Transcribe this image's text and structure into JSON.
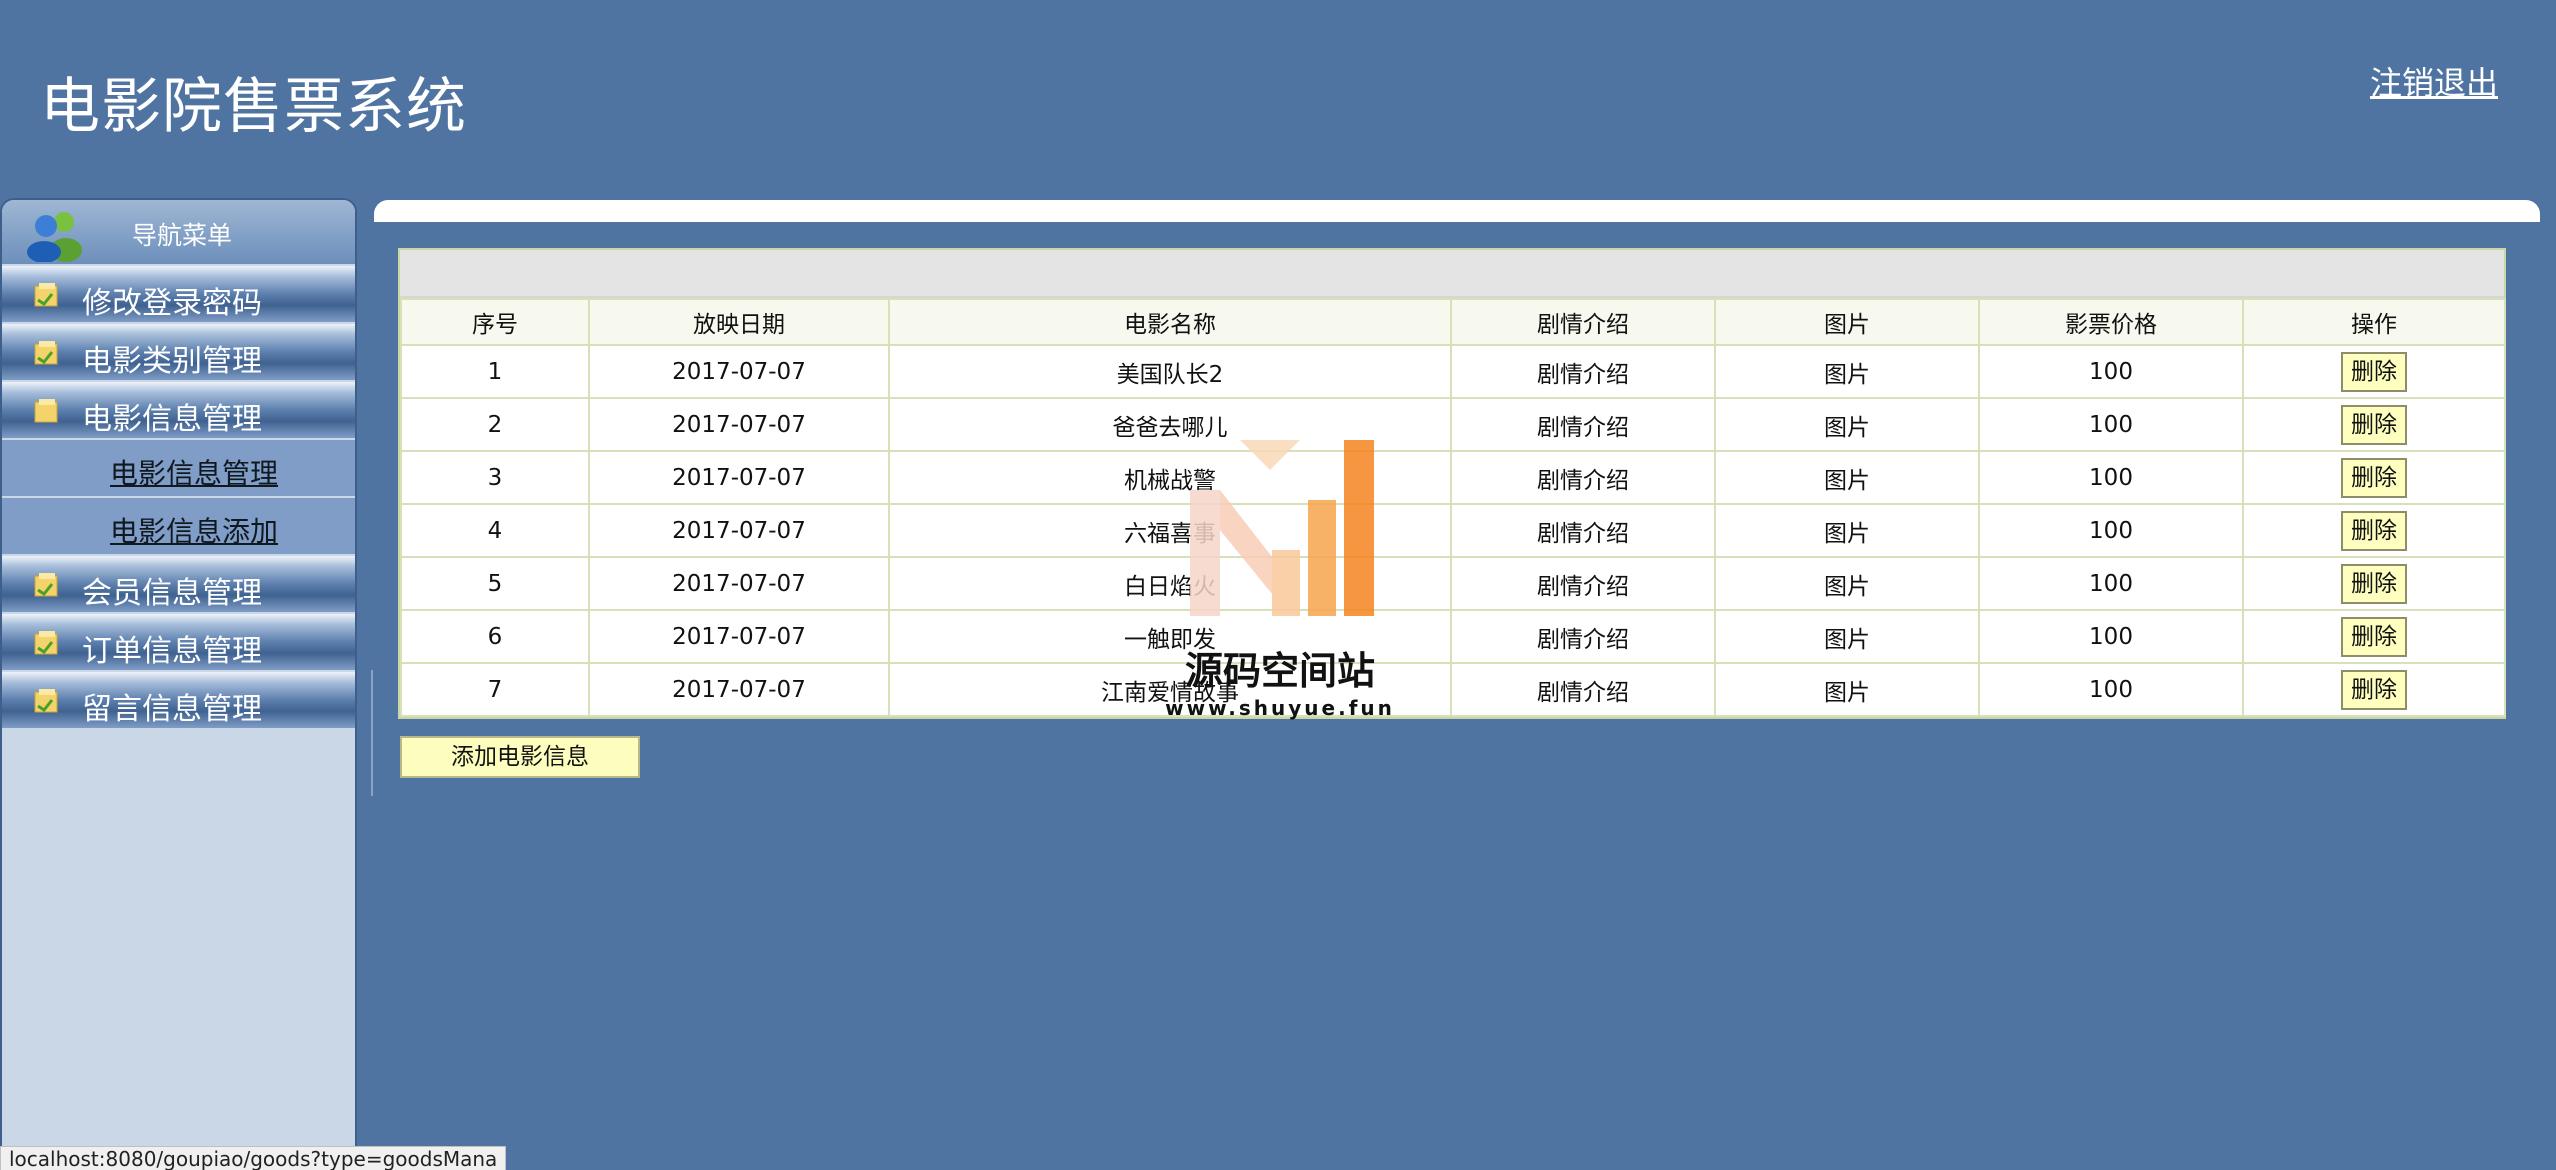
{
  "header": {
    "title": "电影院售票系统",
    "logout_label": "注销退出"
  },
  "sidebar": {
    "header_label": "导航菜单",
    "items": [
      {
        "label": "修改登录密码"
      },
      {
        "label": "电影类别管理"
      },
      {
        "label": "电影信息管理"
      },
      {
        "label": "会员信息管理"
      },
      {
        "label": "订单信息管理"
      },
      {
        "label": "留言信息管理"
      }
    ],
    "subitems": [
      {
        "label": "电影信息管理"
      },
      {
        "label": "电影信息添加"
      }
    ]
  },
  "table": {
    "headers": [
      "序号",
      "放映日期",
      "电影名称",
      "剧情介绍",
      "图片",
      "影票价格",
      "操作"
    ],
    "rows": [
      {
        "id": "1",
        "date": "2017-07-07",
        "name": "美国队长2",
        "plot": "剧情介绍",
        "image": "图片",
        "price": "100",
        "action": "删除"
      },
      {
        "id": "2",
        "date": "2017-07-07",
        "name": "爸爸去哪儿",
        "plot": "剧情介绍",
        "image": "图片",
        "price": "100",
        "action": "删除"
      },
      {
        "id": "3",
        "date": "2017-07-07",
        "name": "机械战警",
        "plot": "剧情介绍",
        "image": "图片",
        "price": "100",
        "action": "删除"
      },
      {
        "id": "4",
        "date": "2017-07-07",
        "name": "六福喜事",
        "plot": "剧情介绍",
        "image": "图片",
        "price": "100",
        "action": "删除"
      },
      {
        "id": "5",
        "date": "2017-07-07",
        "name": "白日焰火",
        "plot": "剧情介绍",
        "image": "图片",
        "price": "100",
        "action": "删除"
      },
      {
        "id": "6",
        "date": "2017-07-07",
        "name": "一触即发",
        "plot": "剧情介绍",
        "image": "图片",
        "price": "100",
        "action": "删除"
      },
      {
        "id": "7",
        "date": "2017-07-07",
        "name": "江南爱情故事",
        "plot": "剧情介绍",
        "image": "图片",
        "price": "100",
        "action": "删除"
      }
    ]
  },
  "add_button_label": "添加电影信息",
  "watermark": {
    "text": "源码空间站",
    "url": "www.shuyue.fun"
  },
  "status_bar_url": "localhost:8080/goupiao/goods?type=goodsMana",
  "icons": {
    "sidebar_header": "users-icon",
    "menu_item": "folder-add-icon"
  },
  "colors": {
    "background": "#4f74a2",
    "sidebar": "#cad7e7",
    "button": "#fefebe",
    "watermark_orange": "#f5841f"
  }
}
